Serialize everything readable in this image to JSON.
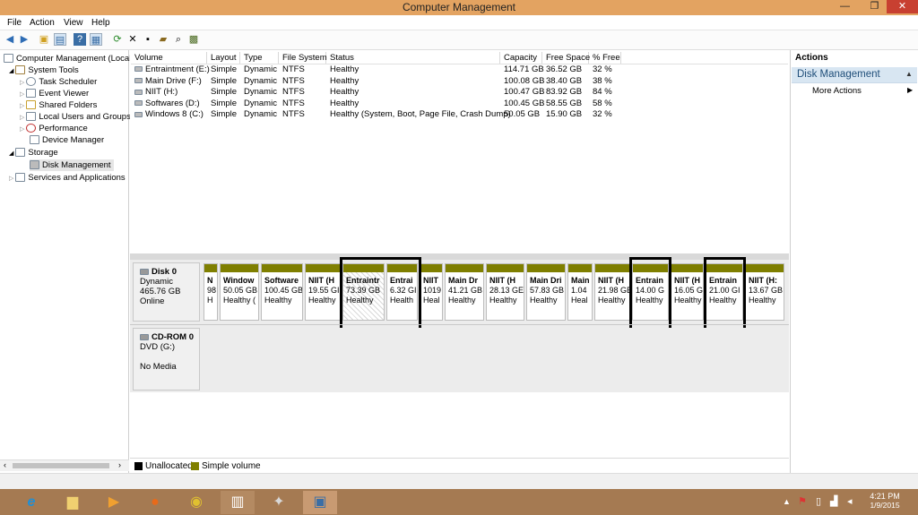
{
  "window": {
    "title": "Computer Management",
    "min": "—",
    "max": "❐",
    "close": "✕"
  },
  "menubar": [
    "File",
    "Action",
    "View",
    "Help"
  ],
  "toolbar_icons": [
    "back-icon",
    "forward-icon",
    "up-folder-icon",
    "show-hide-tree-icon",
    "help-icon",
    "properties-icon",
    "refresh-icon",
    "delete-icon",
    "open-icon",
    "folder-open-icon",
    "search-icon",
    "snapin-icon"
  ],
  "tree": {
    "root": "Computer Management (Local",
    "system_tools": "System Tools",
    "task_scheduler": "Task Scheduler",
    "event_viewer": "Event Viewer",
    "shared_folders": "Shared Folders",
    "local_users": "Local Users and Groups",
    "performance": "Performance",
    "device_manager": "Device Manager",
    "storage": "Storage",
    "disk_management": "Disk Management",
    "services": "Services and Applications"
  },
  "table": {
    "headers": [
      "Volume",
      "Layout",
      "Type",
      "File System",
      "Status",
      "Capacity",
      "Free Space",
      "% Free"
    ],
    "rows": [
      [
        "Entraintment (E:)",
        "Simple",
        "Dynamic",
        "NTFS",
        "Healthy",
        "114.71 GB",
        "36.52 GB",
        "32 %"
      ],
      [
        "Main Drive (F:)",
        "Simple",
        "Dynamic",
        "NTFS",
        "Healthy",
        "100.08 GB",
        "38.40 GB",
        "38 %"
      ],
      [
        "NIIT (H:)",
        "Simple",
        "Dynamic",
        "NTFS",
        "Healthy",
        "100.47 GB",
        "83.92 GB",
        "84 %"
      ],
      [
        "Softwares (D:)",
        "Simple",
        "Dynamic",
        "NTFS",
        "Healthy",
        "100.45 GB",
        "58.55 GB",
        "58 %"
      ],
      [
        "Windows 8 (C:)",
        "Simple",
        "Dynamic",
        "NTFS",
        "Healthy (System, Boot, Page File, Crash Dump)",
        "50.05 GB",
        "15.90 GB",
        "32 %"
      ]
    ]
  },
  "disk0": {
    "name": "Disk 0",
    "type": "Dynamic",
    "size": "465.76 GB",
    "status": "Online"
  },
  "partitions": [
    {
      "name": "N",
      "size": "98",
      "status": "H"
    },
    {
      "name": "Window",
      "size": "50.05 GB",
      "status": "Healthy ("
    },
    {
      "name": "Software",
      "size": "100.45 GB",
      "status": "Healthy"
    },
    {
      "name": "NIIT (H",
      "size": "19.55 GI",
      "status": "Healthy"
    },
    {
      "name": "Entraintr",
      "size": "73.39 GB",
      "status": "Healthy"
    },
    {
      "name": "Entrai",
      "size": "6.32 GI",
      "status": "Health"
    },
    {
      "name": "NIIT",
      "size": "1019",
      "status": "Heal"
    },
    {
      "name": "Main Dr",
      "size": "41.21 GB",
      "status": "Healthy"
    },
    {
      "name": "NIIT (H",
      "size": "28.13 GE",
      "status": "Healthy"
    },
    {
      "name": "Main Dri",
      "size": "57.83 GB",
      "status": "Healthy"
    },
    {
      "name": "Main",
      "size": "1.04",
      "status": "Heal"
    },
    {
      "name": "NIIT (H",
      "size": "21.98 GE",
      "status": "Healthy"
    },
    {
      "name": "Entrain",
      "size": "14.00 G",
      "status": "Healthy"
    },
    {
      "name": "NIIT (H",
      "size": "16.05 G",
      "status": "Healthy"
    },
    {
      "name": "Entrain",
      "size": "21.00 GI",
      "status": "Healthy"
    },
    {
      "name": "NIIT (H:",
      "size": "13.67 GB",
      "status": "Healthy"
    }
  ],
  "cdrom": {
    "name": "CD-ROM 0",
    "type": "DVD (G:)",
    "media": "No Media"
  },
  "legend": {
    "unallocated": "Unallocated",
    "simple": "Simple volume",
    "unalloc_color": "#000000",
    "simple_color": "#7f7f00"
  },
  "actions": {
    "header": "Actions",
    "section": "Disk Management",
    "more": "More Actions"
  },
  "taskbar": {
    "time": "4:21 PM",
    "date": "1/9/2015"
  }
}
